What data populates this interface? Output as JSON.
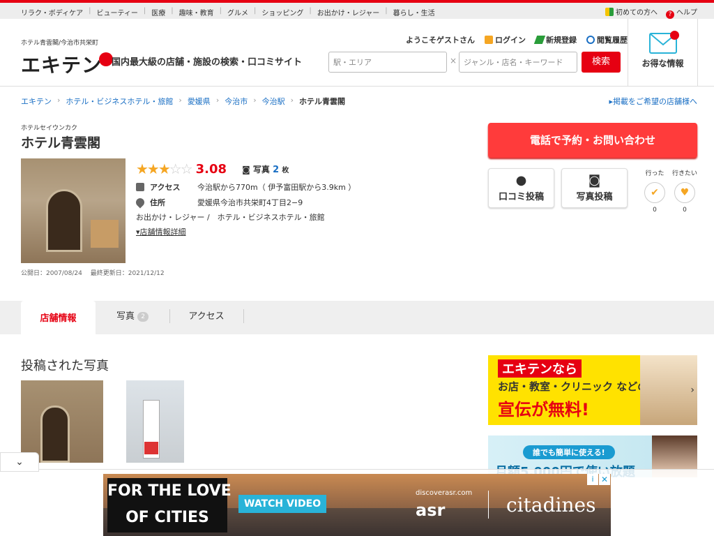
{
  "topnav": [
    "リラク・ボディケア",
    "ビューティー",
    "医療",
    "趣味・教育",
    "グルメ",
    "ショッピング",
    "お出かけ・レジャー",
    "暮らし・生活"
  ],
  "toplinks": {
    "beginner": "初めての方へ",
    "help": "ヘルプ"
  },
  "header": {
    "sub_name": "ホテル青雲閣/今治市共栄町",
    "logo": "エキテン",
    "tagline": "国内最大級の店舗・施設の検索・口コミサイト",
    "welcome": "ようこそゲストさん",
    "login": "ログイン",
    "register": "新規登録",
    "history": "閲覧履歴",
    "area_placeholder": "駅・エリア",
    "keyword_placeholder": "ジャンル・店名・キーワード",
    "x": "×",
    "search": "検索",
    "deal": "お得な情報"
  },
  "breadcrumb": [
    "エキテン",
    "ホテル・ビジネスホテル・旅館",
    "愛媛県",
    "今治市",
    "今治駅"
  ],
  "breadcrumb_current": "ホテル青雲閣",
  "breadcrumb_right": "掲載をご希望の店舗様へ",
  "shop": {
    "kana": "ホテルセイウンカク",
    "name": "ホテル青雲閣",
    "rating": "3.08",
    "stars_on": "★★★",
    "stars_off": "☆☆",
    "photo_label": "写真",
    "photo_count": "2",
    "photo_unit": "枚",
    "access_label": "アクセス",
    "access": "今治駅から770m（ 伊予富田駅から3.9km ）",
    "address_label": "住所",
    "address": "愛媛県今治市共栄町4丁目2−9",
    "category": "お出かけ・レジャー /　ホテル・ビジネスホテル・旅館",
    "detail": "店舗情報詳細",
    "dates": "公開日：2007/08/24　 最終更新日：2021/12/12"
  },
  "actions": {
    "call": "電話で予約・お問い合わせ",
    "review": "口コミ投稿",
    "photo_post": "写真投稿",
    "went": "行った",
    "went_count": "0",
    "want": "行きたい",
    "want_count": "0"
  },
  "tabs": {
    "info": "店舗情報",
    "photo": "写真",
    "photo_count": "2",
    "access": "アクセス"
  },
  "section_title": "投稿された写真",
  "ad1": {
    "l1": "エキテンなら",
    "l2": "お店・教室・クリニック などの",
    "l3": "宣伝が無料!"
  },
  "ad2": {
    "pill": "誰でも簡単に使える!",
    "big": "月額5,000円で使い放題"
  },
  "banner": {
    "ftl1": "FOR THE LOVE",
    "ftl2": "OF CITIES",
    "watch": "WATCH VIDEO",
    "disc": "discoverasr.com",
    "asr": "asr",
    "cit": "citadines"
  },
  "colors": {
    "accent": "#e60012",
    "link": "#1a6fc4",
    "cta": "#ff3b3b"
  }
}
